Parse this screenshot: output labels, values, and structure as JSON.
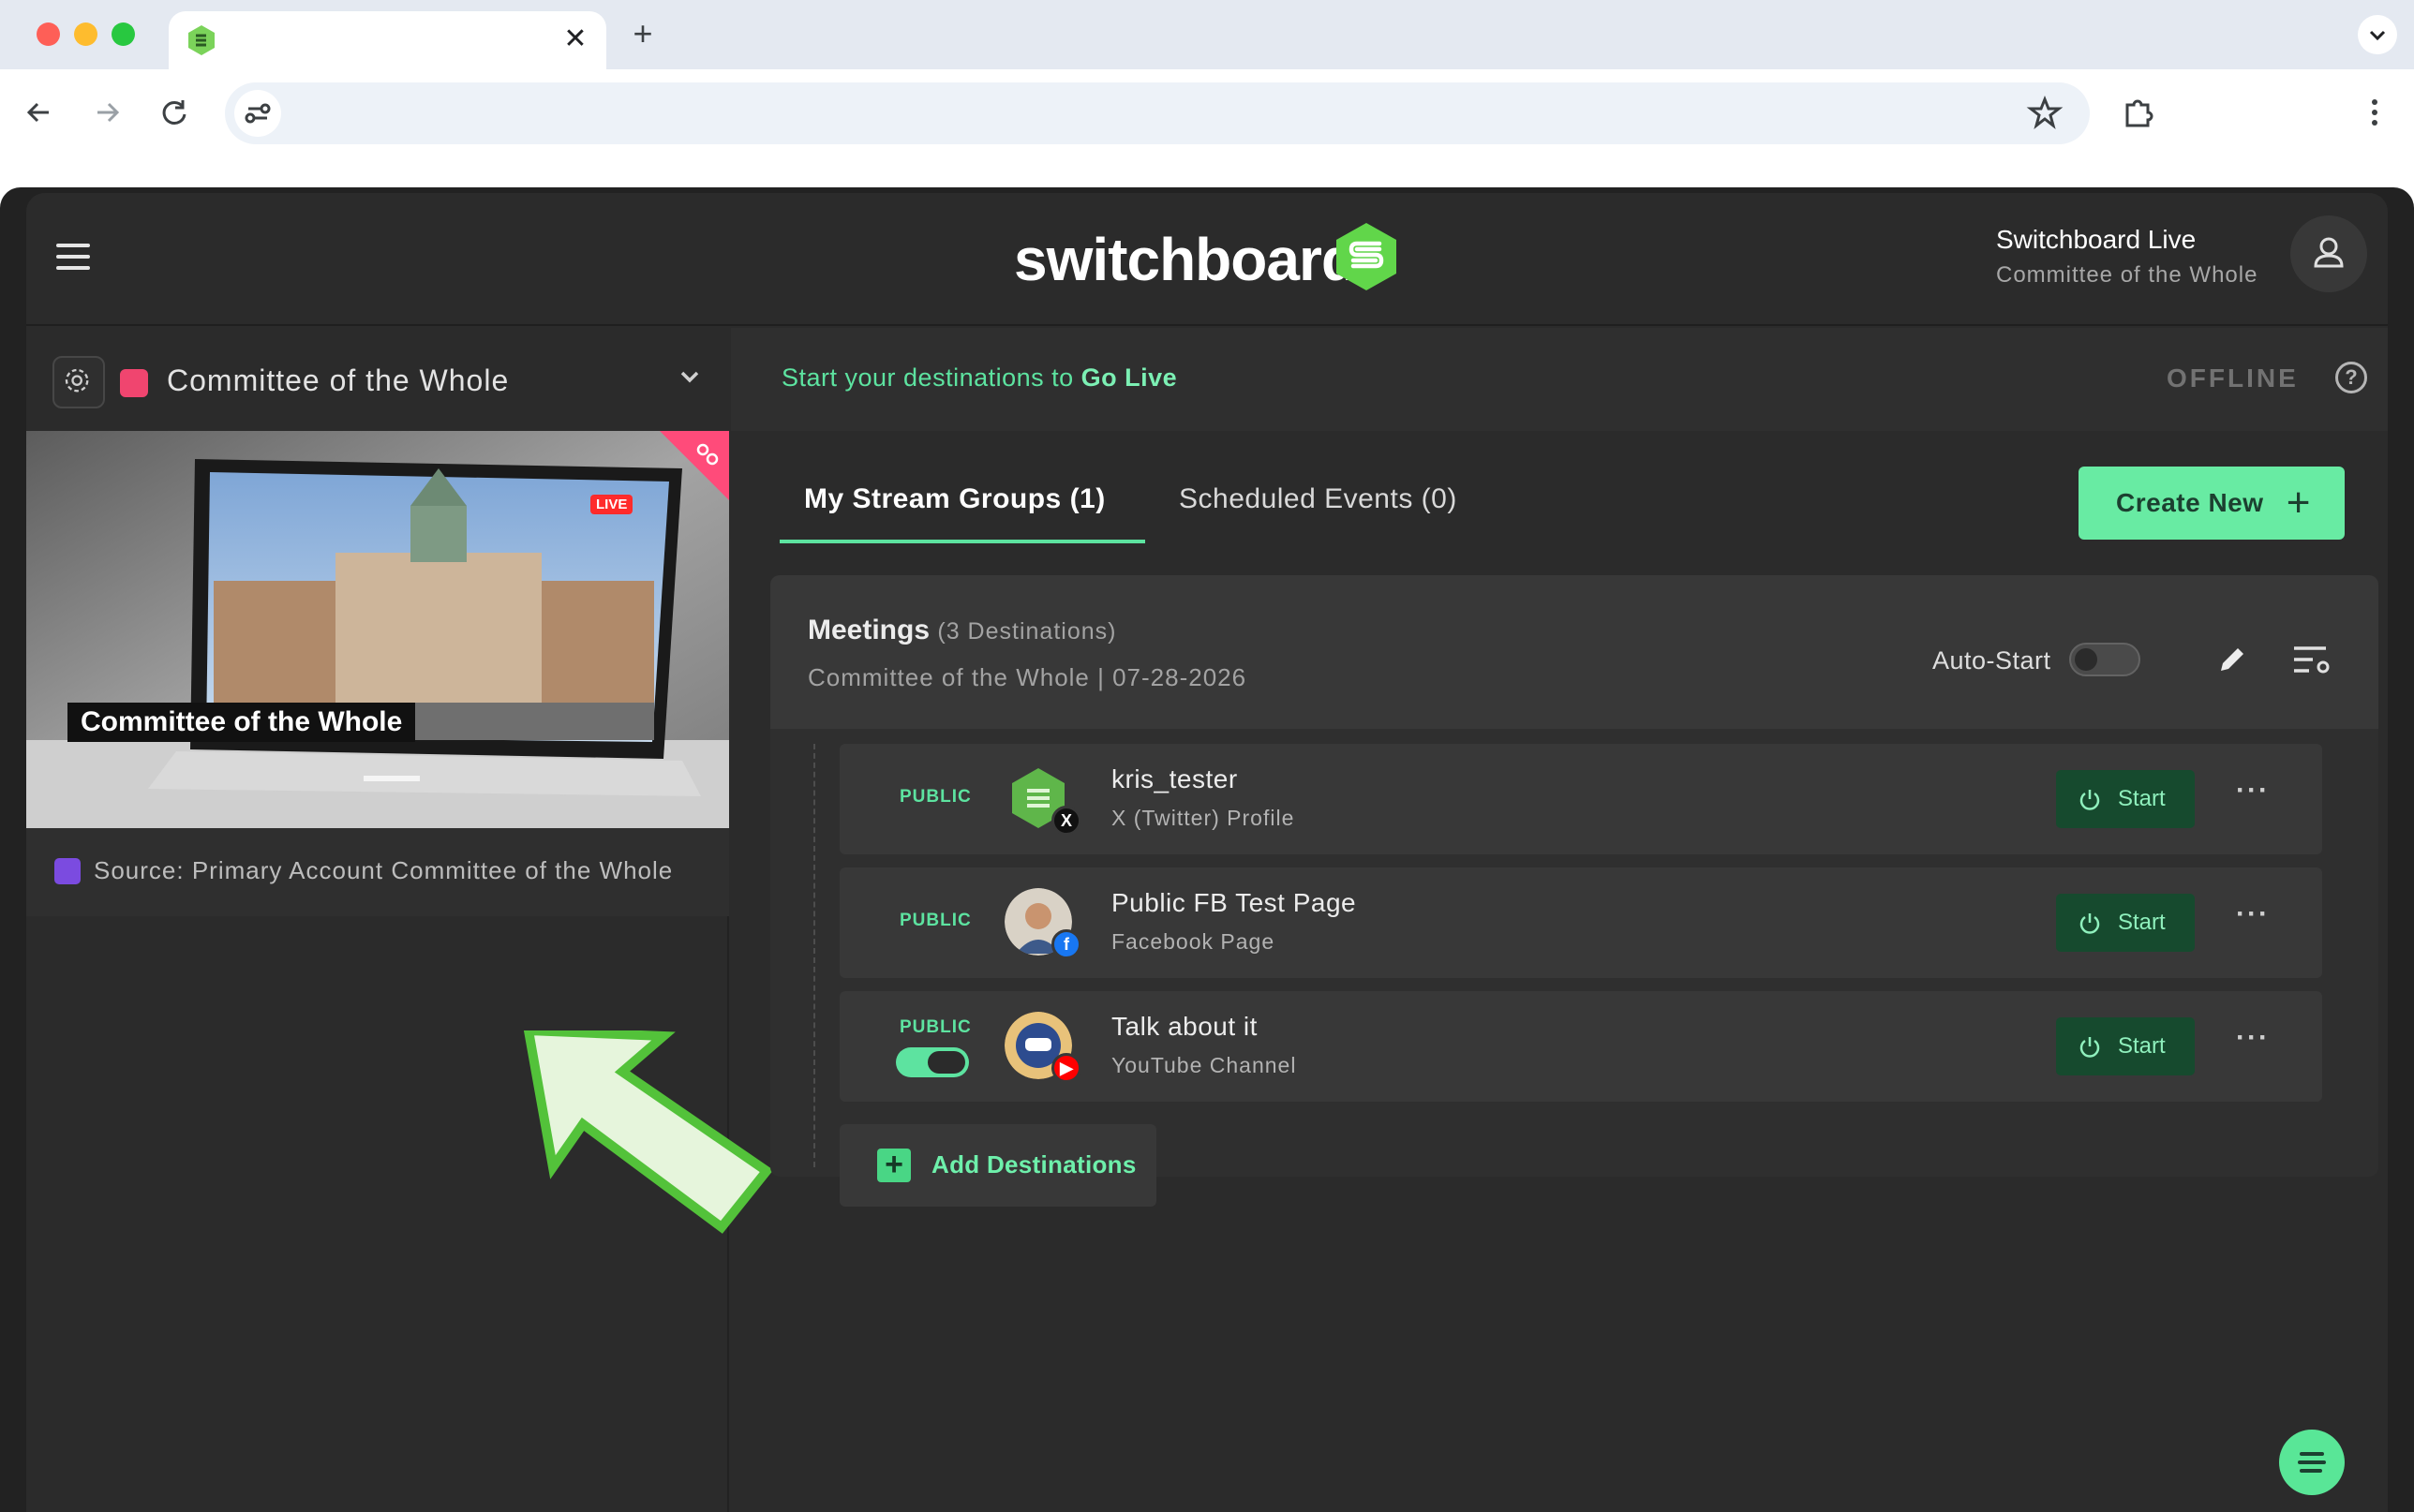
{
  "browser": {
    "tab": {
      "title": "",
      "close_glyph": "✕"
    },
    "new_tab_glyph": "+",
    "icons": [
      "back-arrow-icon",
      "forward-arrow-icon",
      "reload-icon",
      "site-settings-icon",
      "star-icon",
      "extensions-icon",
      "kebab-menu-icon"
    ]
  },
  "header": {
    "logo_text": "switchboard",
    "account_name": "Switchboard Live",
    "account_sub": "Committee of the Whole"
  },
  "left": {
    "group_name": "Committee of the Whole",
    "preview_title": "Committee of the Whole",
    "live_badge": "LIVE",
    "source_text": "Source: Primary Account  Committee of the Whole"
  },
  "status": {
    "prefix": "Start your destinations to ",
    "emphasis": "Go Live",
    "state": "OFFLINE",
    "help_glyph": "?"
  },
  "tabs": {
    "active": "My Stream Groups (1)",
    "inactive": "Scheduled Events (0)",
    "create_label": "Create New",
    "create_glyph": "+"
  },
  "stream_group": {
    "title": "Meetings",
    "count": "(3 Destinations)",
    "subtitle": "Committee of the Whole | 07-28-2026",
    "autostart_label": "Auto-Start",
    "autostart_on": false
  },
  "destinations": [
    {
      "visibility": "PUBLIC",
      "name": "kris_tester",
      "type": "X (Twitter) Profile",
      "action": "Start",
      "platform": "x-icon",
      "has_toggle": false
    },
    {
      "visibility": "PUBLIC",
      "name": "Public FB Test Page",
      "type": "Facebook Page",
      "action": "Start",
      "platform": "facebook-icon",
      "has_toggle": false
    },
    {
      "visibility": "PUBLIC",
      "name": "Talk about it",
      "type": "YouTube Channel",
      "action": "Start",
      "platform": "youtube-icon",
      "has_toggle": true
    }
  ],
  "more_glyph": "···",
  "add_destinations": {
    "glyph": "+",
    "label": "Add Destinations"
  },
  "colors": {
    "accent": "#5de3a0",
    "create_button": "#68eba3",
    "start_button": "#164a2e",
    "group_swatch": "#f0456f",
    "source_swatch": "#7b4be0"
  }
}
